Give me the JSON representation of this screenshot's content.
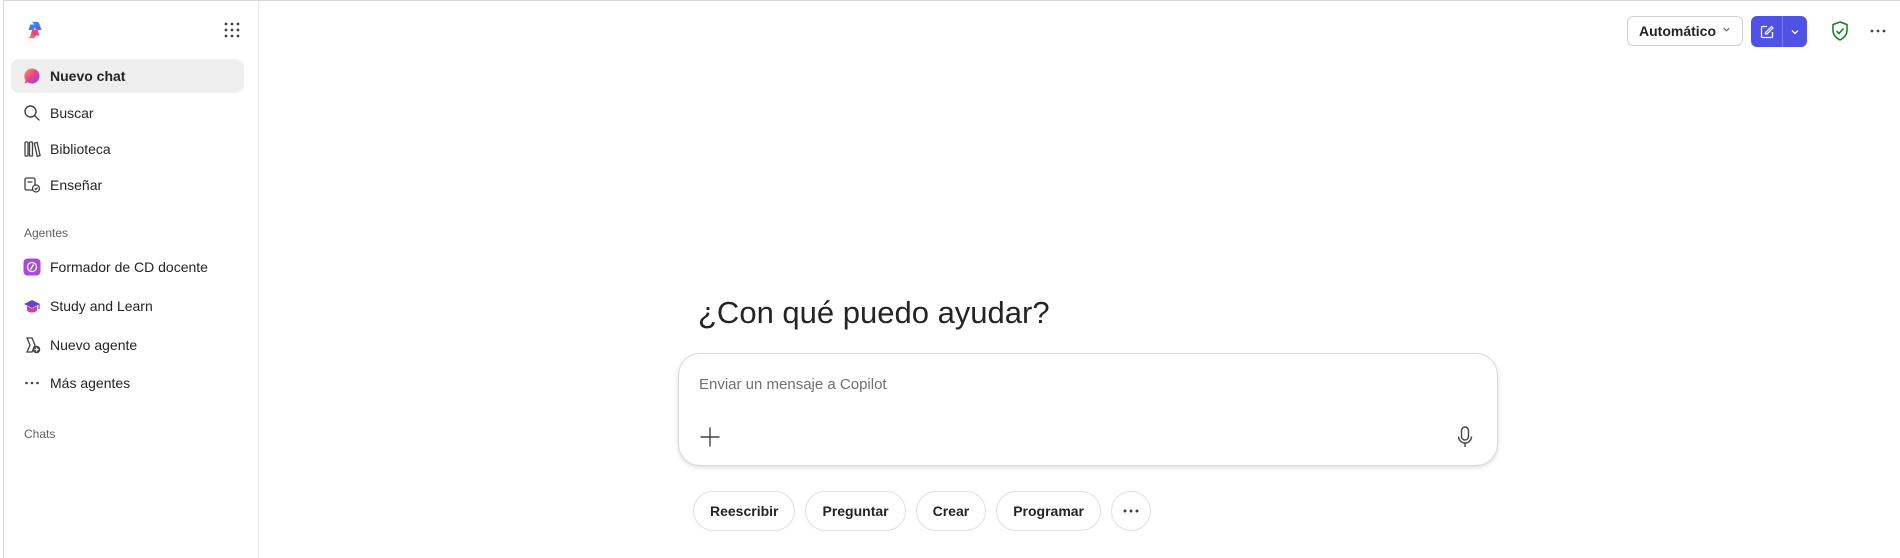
{
  "sidebar": {
    "logo_icon": "copilot-logo",
    "apps_icon": "app-launcher-grid-icon",
    "nav": [
      {
        "label": "Nuevo chat",
        "icon": "copilot-chat-icon"
      },
      {
        "label": "Buscar",
        "icon": "search-icon"
      },
      {
        "label": "Biblioteca",
        "icon": "library-icon"
      },
      {
        "label": "Enseñar",
        "icon": "teach-icon"
      }
    ],
    "agents_heading": "Agentes",
    "agents": [
      {
        "label": "Formador de CD docente",
        "icon": "agent-purple-icon"
      },
      {
        "label": "Study and Learn",
        "icon": "graduation-cap-icon"
      },
      {
        "label": "Nuevo agente",
        "icon": "new-agent-icon"
      },
      {
        "label": "Más agentes",
        "icon": "more-icon"
      }
    ],
    "chats_heading": "Chats"
  },
  "header": {
    "mode_label": "Automático",
    "accent": "#4f52e6"
  },
  "main": {
    "greeting": "¿Con qué puedo ayudar?",
    "composer_placeholder": "Enviar un mensaje a Copilot",
    "chips": [
      "Reescribir",
      "Preguntar",
      "Crear",
      "Programar"
    ]
  }
}
